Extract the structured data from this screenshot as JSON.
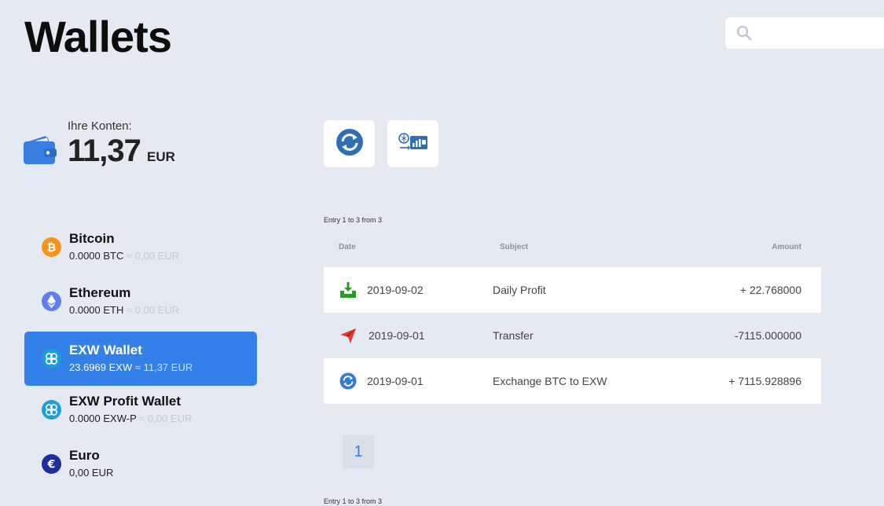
{
  "header": {
    "title": "Wallets",
    "search": {
      "value": "",
      "placeholder": ""
    }
  },
  "balance": {
    "label": "Ihre Konten:",
    "amount": "11,37",
    "currency": "EUR"
  },
  "actions": [
    {
      "name": "exchange",
      "icon": "exchange-icon"
    },
    {
      "name": "wallet-chart",
      "icon": "wallet-chart-icon"
    }
  ],
  "wallets": [
    {
      "name": "Bitcoin",
      "amount": "0.0000 BTC",
      "approx": "≈ 0,00 EUR",
      "icon": "bitcoin-icon",
      "color": "#f7931a"
    },
    {
      "name": "Ethereum",
      "amount": "0.0000 ETH",
      "approx": "≈ 0,00 EUR",
      "icon": "ethereum-icon",
      "color": "#627eea"
    },
    {
      "name": "EXW Wallet",
      "amount": "23.6969 EXW",
      "approx": "≈ 11,37 EUR",
      "icon": "exw-icon",
      "color": "#1e9ed6",
      "active": true
    },
    {
      "name": "EXW Profit Wallet",
      "amount": "0.0000 EXW-P",
      "approx": "≈ 0,00 EUR",
      "icon": "exw-profit-icon",
      "color": "#1e9ed6"
    },
    {
      "name": "Euro",
      "amount": "0,00 EUR",
      "approx": "",
      "icon": "euro-icon",
      "color": "#1c2f9c"
    }
  ],
  "table": {
    "entries_info": "Entry 1 to 3 from 3",
    "columns": {
      "date": "Date",
      "subject": "Subject",
      "amount": "Amount"
    },
    "rows": [
      {
        "date": "2019-09-02",
        "subject": "Daily Profit",
        "amount": "+ 22.768000",
        "icon": "download-icon"
      },
      {
        "date": "2019-09-01",
        "subject": "Transfer",
        "amount": "-7115.000000",
        "icon": "send-icon"
      },
      {
        "date": "2019-09-01",
        "subject": "Exchange BTC to EXW",
        "amount": "+ 7115.928896",
        "icon": "exchange-icon"
      }
    ]
  },
  "pagination": {
    "current": "1"
  },
  "colors": {
    "background": "#e5e9f1",
    "accent": "#3280e8",
    "wallet_icon": "#3a7ee4"
  }
}
